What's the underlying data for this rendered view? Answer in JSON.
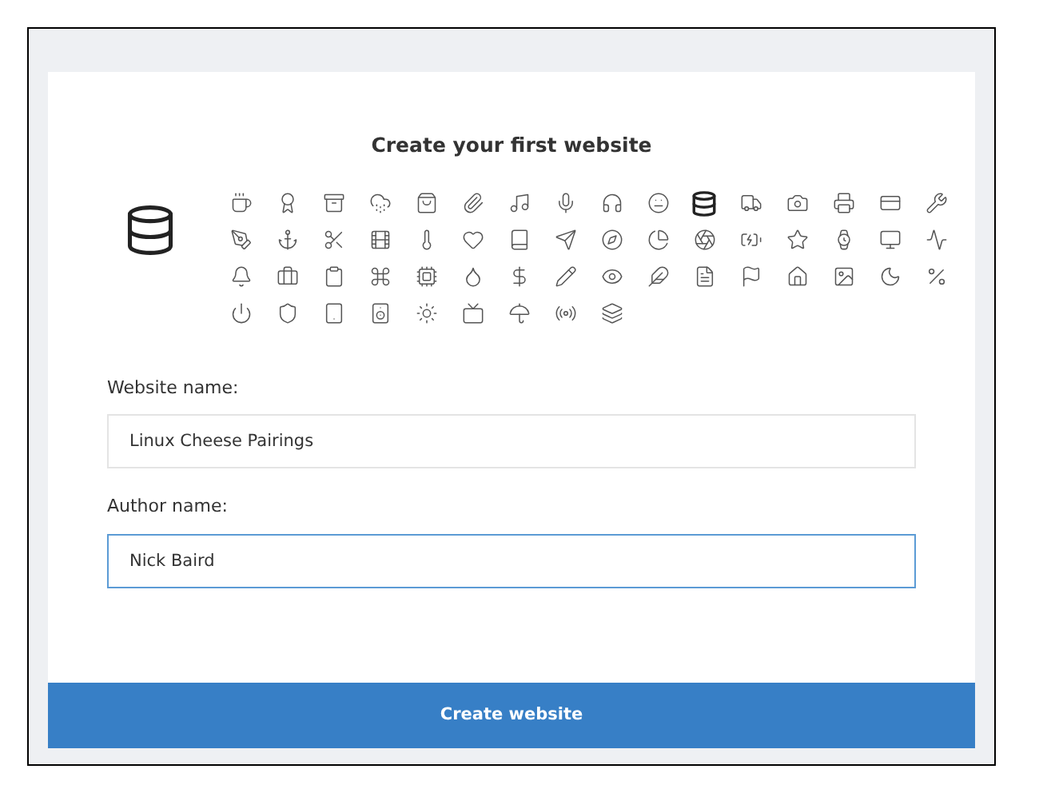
{
  "title": "Create your first website",
  "icons": [
    {
      "selected": false
    },
    {
      "selected": false
    },
    {
      "selected": false
    },
    {
      "selected": false
    },
    {
      "selected": false
    },
    {
      "selected": false
    },
    {
      "selected": false
    },
    {
      "selected": false
    },
    {
      "selected": false
    },
    {
      "selected": false
    },
    {
      "selected": true
    },
    {
      "selected": false
    },
    {
      "selected": false
    },
    {
      "selected": false
    },
    {
      "selected": false
    },
    {
      "selected": false
    },
    {
      "selected": false
    },
    {
      "selected": false
    },
    {
      "selected": false
    },
    {
      "selected": false
    },
    {
      "selected": false
    },
    {
      "selected": false
    },
    {
      "selected": false
    },
    {
      "selected": false
    },
    {
      "selected": false
    },
    {
      "selected": false
    },
    {
      "selected": false
    },
    {
      "selected": false
    },
    {
      "selected": false
    },
    {
      "selected": false
    },
    {
      "selected": false
    },
    {
      "selected": false
    },
    {
      "selected": false
    },
    {
      "selected": false
    },
    {
      "selected": false
    },
    {
      "selected": false
    },
    {
      "selected": false
    },
    {
      "selected": false
    },
    {
      "selected": false
    },
    {
      "selected": false
    },
    {
      "selected": false
    },
    {
      "selected": false
    },
    {
      "selected": false
    },
    {
      "selected": false
    },
    {
      "selected": false
    },
    {
      "selected": false
    },
    {
      "selected": false
    },
    {
      "selected": false
    },
    {
      "selected": false
    },
    {
      "selected": false
    },
    {
      "selected": false
    },
    {
      "selected": false
    },
    {
      "selected": false
    },
    {
      "selected": false
    },
    {
      "selected": false
    },
    {
      "selected": false
    },
    {
      "selected": false
    }
  ],
  "fields": [
    {
      "label": "Website name:",
      "value": "Linux Cheese Pairings",
      "focused": false
    },
    {
      "label": "Author name:",
      "value": "Nick Baird",
      "focused": true
    }
  ],
  "submit": "Create website"
}
